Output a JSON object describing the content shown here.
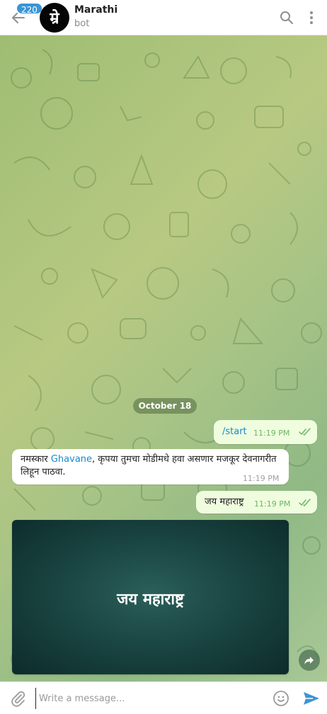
{
  "header": {
    "unread_badge": "220",
    "avatar_letter": "म्रे",
    "title": "Marathi",
    "subtitle": "bot"
  },
  "chat": {
    "date_label": "October 18",
    "messages": [
      {
        "direction": "out",
        "text": "/start",
        "time": "11:19 PM"
      },
      {
        "direction": "in",
        "text_before": "नमस्कार ",
        "mention": "Ghavane",
        "text_after": ", कृपया तुमचा मोडीमधे हवा असणार मजकूर देवनागरीत लिहून पाठवा.",
        "time": "11:19 PM"
      },
      {
        "direction": "out",
        "text": "जय महाराष्ट्र",
        "time": "11:19 PM"
      }
    ],
    "photo_caption": "जय महाराष्ट्र"
  },
  "input": {
    "placeholder": "Write a message..."
  },
  "icons": {
    "back": "arrow-left-icon",
    "search": "search-icon",
    "more": "more-vertical-icon",
    "attach": "paperclip-icon",
    "emoji": "smiley-icon",
    "send": "send-icon",
    "share": "forward-icon",
    "ticks": "double-check-icon"
  },
  "colors": {
    "accent": "#3a95d5",
    "link": "#168acd",
    "outgoing_bubble": "#effdde",
    "read_ticks": "#6db566"
  }
}
